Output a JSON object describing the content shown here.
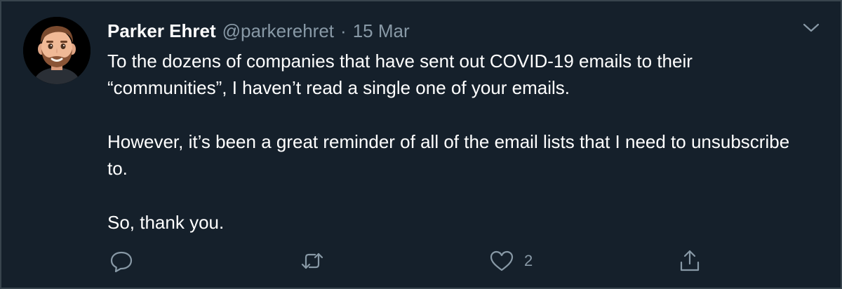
{
  "author": {
    "name": "Parker Ehret",
    "handle": "@parkerehret",
    "separator": "·",
    "date": "15 Mar"
  },
  "tweet": {
    "paragraphs": [
      "To the dozens of companies that have sent out COVID-19 emails to their “communities”, I haven’t read a single one of your emails.",
      "However, it’s been a great reminder of all of the email lists that I need to unsubscribe to.",
      "So, thank you."
    ]
  },
  "actions": {
    "reply": {
      "icon": "reply-icon",
      "count": ""
    },
    "retweet": {
      "icon": "retweet-icon",
      "count": ""
    },
    "like": {
      "icon": "heart-icon",
      "count": "2"
    },
    "share": {
      "icon": "share-icon",
      "count": ""
    }
  },
  "menu": {
    "icon": "chevron-down-icon"
  },
  "colors": {
    "background": "#15202b",
    "border": "#38444d",
    "text_primary": "#ffffff",
    "text_secondary": "#8899a6"
  }
}
